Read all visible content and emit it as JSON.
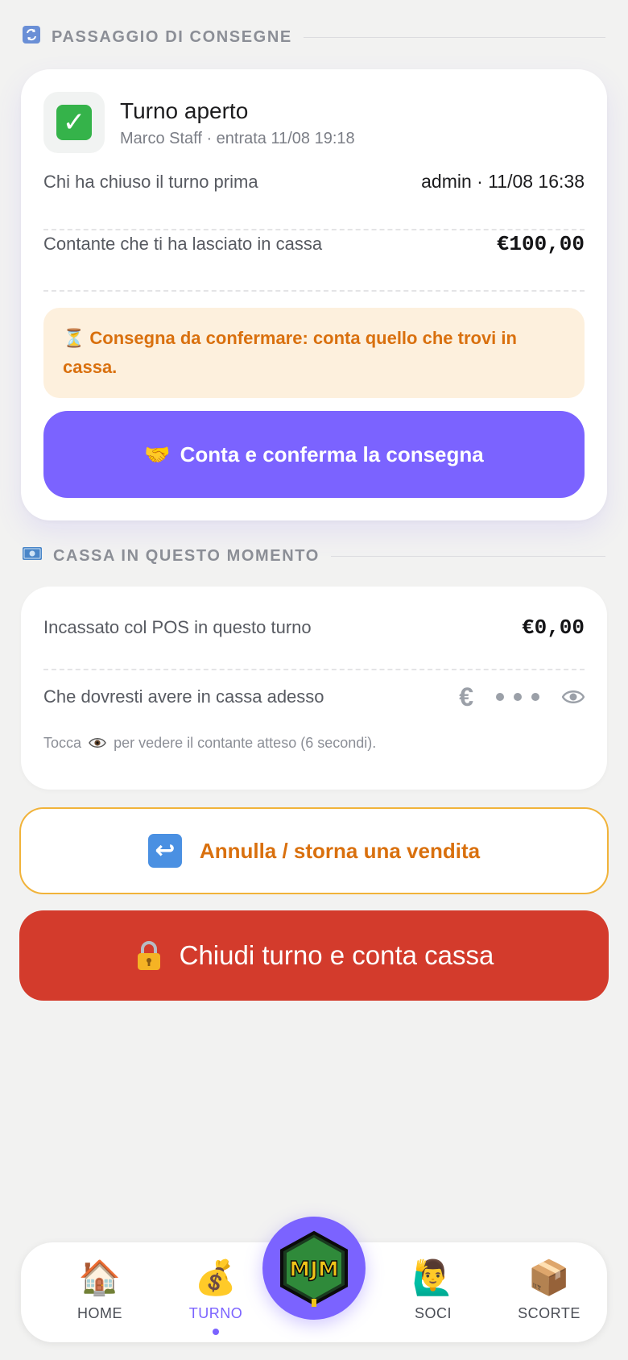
{
  "handover_section": {
    "icon": "counterclockwise-arrows-icon",
    "title": "PASSAGGIO DI CONSEGNE"
  },
  "shift": {
    "status_icon": "check-mark-icon",
    "title": "Turno aperto",
    "subtitle": "Marco Staff · entrata 11/08 19:18",
    "prev_closed_label": "Chi ha chiuso il turno prima",
    "prev_closed_value": "admin · 11/08 16:38",
    "cash_left_label": "Contante che ti ha lasciato in cassa",
    "cash_left_value": "€100,00",
    "notice": "Consegna da confermare: conta quello che trovi in cassa.",
    "confirm_button": "Conta e conferma la consegna"
  },
  "cash_section": {
    "icon": "banknote-icon",
    "title": "CASSA IN QUESTO MOMENTO",
    "pos_label": "Incassato col POS in questo turno",
    "pos_value": "€0,00",
    "expected_label": "Che dovresti avere in cassa adesso",
    "expected_masked_symbol": "€",
    "hint_before": "Tocca",
    "hint_after": "per vedere il contante atteso (6 secondi)."
  },
  "actions": {
    "undo_label": "Annulla / storna una vendita",
    "close_label": "Chiudi turno e conta cassa"
  },
  "nav": {
    "home": "HOME",
    "turno": "TURNO",
    "soci": "SOCI",
    "scorte": "SCORTE",
    "active": "TURNO",
    "logo_text": "MJM"
  },
  "colors": {
    "accent": "#7b63ff",
    "warning": "#d9700e",
    "danger": "#d33b2c",
    "notice_bg": "#fdf0dd"
  }
}
